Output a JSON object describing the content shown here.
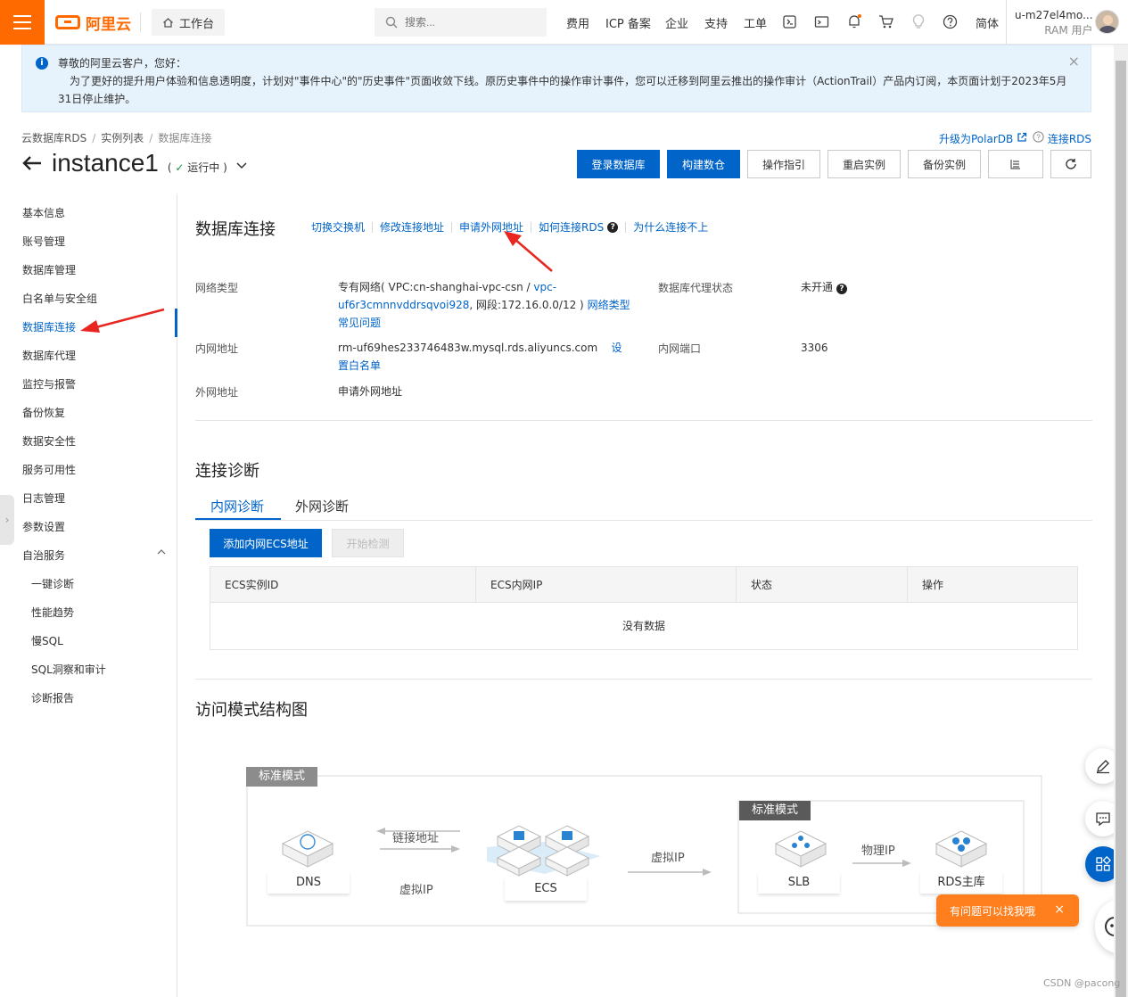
{
  "topbar": {
    "logo_text": "阿里云",
    "workbench": "工作台",
    "search_placeholder": "搜索...",
    "nav": [
      "费用",
      "ICP 备案",
      "企业",
      "支持",
      "工单"
    ],
    "lang": "简体",
    "user_name": "u-m27el4mo...",
    "user_role": "RAM 用户"
  },
  "notice": {
    "greeting": "尊敬的阿里云客户，您好：",
    "body": "为了更好的提升用户体验和信息透明度，计划对\"事件中心\"的\"历史事件\"页面收敛下线。原历史事件中的操作审计事件，您可以迁移到阿里云推出的操作审计（ActionTrail）产品内订阅，本页面计划于2023年5月31日停止维护。",
    "close": "×"
  },
  "breadcrumb": [
    "云数据库RDS",
    "实例列表",
    "数据库连接"
  ],
  "header": {
    "instance_name": "instance1",
    "status_open": "(",
    "status_text": "运行中",
    "status_close": ")",
    "upgrade_link": "升级为PolarDB",
    "connect_link": "连接RDS",
    "buttons": {
      "login_db": "登录数据库",
      "build_warehouse": "构建数仓",
      "guide": "操作指引",
      "restart": "重启实例",
      "backup": "备份实例"
    }
  },
  "sidebar": {
    "items": [
      "基本信息",
      "账号管理",
      "数据库管理",
      "白名单与安全组",
      "数据库连接",
      "数据库代理",
      "监控与报警",
      "备份恢复",
      "数据安全性",
      "服务可用性",
      "日志管理",
      "参数设置",
      "自治服务"
    ],
    "sub_items": [
      "一键诊断",
      "性能趋势",
      "慢SQL",
      "SQL洞察和审计",
      "诊断报告"
    ],
    "active": "数据库连接"
  },
  "connection": {
    "title": "数据库连接",
    "links": [
      "切换交换机",
      "修改连接地址",
      "申请外网地址",
      "如何连接RDS",
      "为什么连接不上"
    ],
    "network_type_label": "网络类型",
    "network_type_prefix": "专有网络( VPC:cn-shanghai-vpc-csn / ",
    "vpc_id": "vpc-uf6r3cmnnvddrsqvoi928",
    "network_segment": ", 网段:172.16.0.0/12 )",
    "network_faq": "网络类型常见问题",
    "proxy_status_label": "数据库代理状态",
    "proxy_status_value": "未开通",
    "intranet_addr_label": "内网地址",
    "intranet_addr_value": "rm-uf69hes233746483w.mysql.rds.aliyuncs.com",
    "set_whitelist": "设置白名单",
    "intranet_port_label": "内网端口",
    "intranet_port_value": "3306",
    "extranet_addr_label": "外网地址",
    "extranet_apply": "申请外网地址"
  },
  "diagnosis": {
    "title": "连接诊断",
    "tabs": [
      "内网诊断",
      "外网诊断"
    ],
    "add_button": "添加内网ECS地址",
    "start_button": "开始检测",
    "columns": [
      "ECS实例ID",
      "ECS内网IP",
      "状态",
      "操作"
    ],
    "empty": "没有数据"
  },
  "access": {
    "title": "访问模式结构图",
    "mode_tag_1": "标准模式",
    "mode_tag_2": "标准模式",
    "dns": "DNS",
    "ecs": "ECS",
    "slb": "SLB",
    "rds": "RDS主库",
    "link_addr": "链接地址",
    "virtual_ip_1": "虚拟IP",
    "virtual_ip_2": "虚拟IP",
    "physical_ip": "物理IP"
  },
  "floating": {
    "help_pill": "有问题可以找我哦",
    "close": "×"
  },
  "watermark": "CSDN @pacong",
  "colors": {
    "brand": "#ff6a00",
    "primary": "#0064c8",
    "notice_bg": "#e6f2fc",
    "status_ok": "#1e8e3e",
    "annotation_arrow": "#e8251f"
  }
}
